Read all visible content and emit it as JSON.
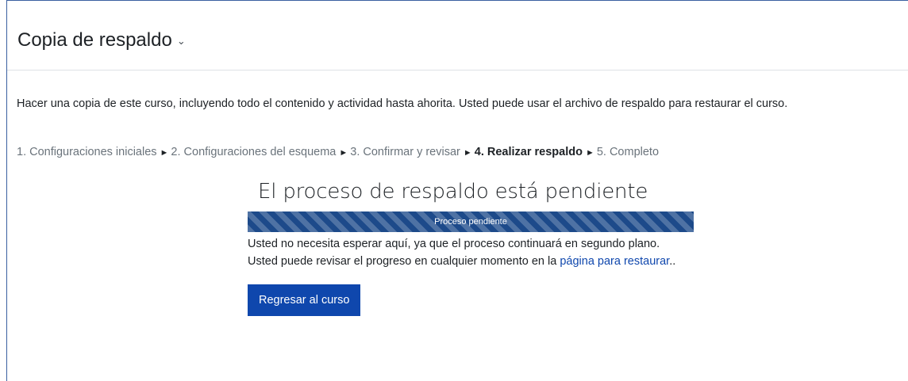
{
  "header": {
    "title": "Copia de respaldo",
    "chevron_icon": "chevron-down-icon"
  },
  "intro": "Hacer una copia de este curso, incluyendo todo el contenido y actividad hasta ahorita. Usted puede usar el archivo de respaldo para restaurar el curso.",
  "steps": {
    "items": [
      "1. Configuraciones iniciales",
      "2. Configuraciones del esquema",
      "3. Confirmar y revisar",
      "4. Realizar respaldo",
      "5. Completo"
    ],
    "separator": "►",
    "current_index": 3
  },
  "main": {
    "heading": "El proceso de respaldo está pendiente",
    "progress": {
      "label": "Proceso pendiente",
      "value": 1.0
    },
    "message_line1": "Usted no necesita esperar aquí, ya que el proceso continuará en segundo plano.",
    "message_line2_prefix": "Usted puede revisar el progreso en cualquier momento en la ",
    "message_link": "página para restaurar",
    "message_line2_suffix": "..",
    "button_label": "Regresar al curso"
  },
  "colors": {
    "primary": "#0f47ad",
    "progress_bar": "#1d4a8a",
    "muted_text": "#6a737b"
  }
}
